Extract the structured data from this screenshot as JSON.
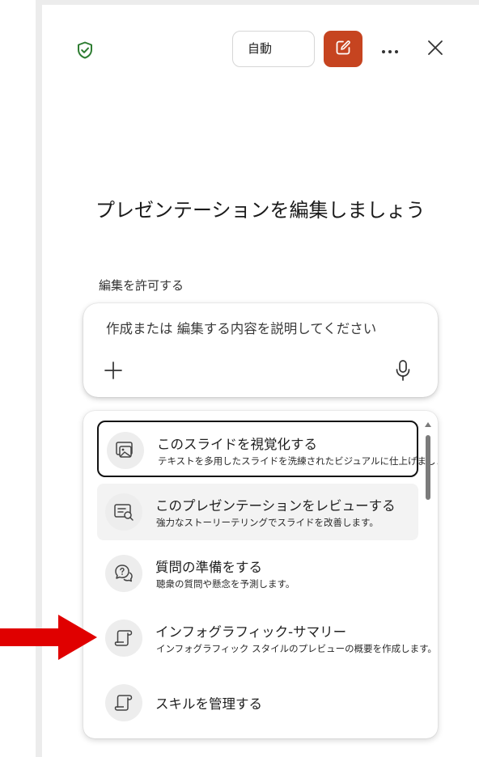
{
  "header": {
    "mode_button_label": "自動",
    "icons": [
      "shield-check-icon",
      "new-edit-icon",
      "more-icon",
      "close-icon"
    ]
  },
  "main": {
    "heading": "プレゼンテーションを編集しましょう",
    "permission_label": "編集を許可する"
  },
  "compose": {
    "placeholder": "作成または 編集する内容を説明してください",
    "icons": [
      "plus-icon",
      "mic-icon"
    ]
  },
  "suggestions": [
    {
      "title": "このスライドを視覚化する",
      "description": "テキストを多用したスライドを洗練されたビジュアルに仕上げましょう。",
      "icon": "image-slide-icon",
      "state": "focused"
    },
    {
      "title": "このプレゼンテーションをレビューする",
      "description": "強力なストーリーテリングでスライドを改善します。",
      "icon": "review-slide-icon",
      "state": "hovered"
    },
    {
      "title": "質問の準備をする",
      "description": "聴衆の質問や懸念を予測します。",
      "icon": "question-chat-icon",
      "state": "normal"
    },
    {
      "title": "インフォグラフィック-サマリー",
      "description": "インフォグラフィック スタイルのプレビューの概要を作成します。",
      "icon": "scroll-icon",
      "state": "normal"
    },
    {
      "title": "スキルを管理する",
      "icon": "scroll-icon",
      "state": "normal"
    }
  ],
  "colors": {
    "accent": "#c64420",
    "shield": "#2e7d32",
    "annotation_arrow": "#e00000"
  }
}
